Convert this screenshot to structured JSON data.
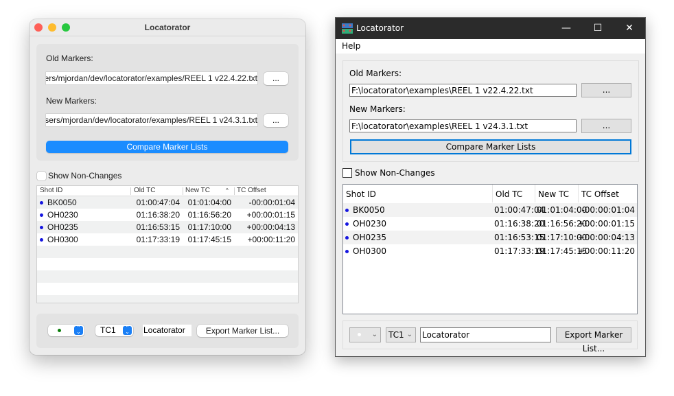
{
  "mac_window": {
    "title": "Locatorator",
    "traffic_lights": {
      "close": "#fe5f57",
      "minimize": "#febc2e",
      "zoom": "#28c840"
    },
    "old_markers_label": "Old Markers:",
    "old_markers_path": "ers/mjordan/dev/locatorator/examples/REEL 1 v22.4.22.txt",
    "browse_old_label": "...",
    "new_markers_label": "New Markers:",
    "new_markers_path": "sers/mjordan/dev/locatorator/examples/REEL 1 v24.3.1.txt",
    "browse_new_label": "...",
    "compare_label": "Compare Marker Lists",
    "show_non_changes_label": "Show Non-Changes",
    "show_non_changes_checked": false,
    "table": {
      "headers": [
        "Shot ID",
        "Old TC",
        "New TC",
        "TC Offset"
      ],
      "sort_indicator": "^",
      "rows": [
        {
          "id": "BK0050",
          "old": "01:00:47:04",
          "new": "01:01:04:00",
          "offset": "-00:00:01:04"
        },
        {
          "id": "OH0230",
          "old": "01:16:38:20",
          "new": "01:16:56:20",
          "offset": "+00:00:01:15"
        },
        {
          "id": "OH0235",
          "old": "01:16:53:15",
          "new": "01:17:10:00",
          "offset": "+00:00:04:13"
        },
        {
          "id": "OH0300",
          "old": "01:17:33:19",
          "new": "01:17:45:15",
          "offset": "+00:00:11:20"
        }
      ]
    },
    "marker_color_select": {
      "value": "green-dot",
      "color": "#0a7d0a"
    },
    "track_select": "TC1",
    "marker_name": "Locatorator",
    "export_label": "Export Marker List..."
  },
  "win_window": {
    "title": "Locatorator",
    "minimize_glyph": "—",
    "maximize_glyph": "☐",
    "close_glyph": "✕",
    "menu": [
      "Help"
    ],
    "old_markers_label": "Old Markers:",
    "old_markers_path": "F:\\locatorator\\examples\\REEL 1 v22.4.22.txt",
    "browse_old_label": "...",
    "new_markers_label": "New Markers:",
    "new_markers_path": "F:\\locatorator\\examples\\REEL 1 v24.3.1.txt",
    "browse_new_label": "...",
    "compare_label": "Compare Marker Lists",
    "show_non_changes_label": "Show Non-Changes",
    "show_non_changes_checked": false,
    "table": {
      "headers": [
        "Shot ID",
        "Old TC",
        "New TC",
        "TC Offset"
      ],
      "sort_indicator": "^",
      "rows": [
        {
          "id": "BK0050",
          "old": "01:00:47:04",
          "new": "01:01:04:00",
          "offset": "-00:00:01:04"
        },
        {
          "id": "OH0230",
          "old": "01:16:38:20",
          "new": "01:16:56:20",
          "offset": "+00:00:01:15"
        },
        {
          "id": "OH0235",
          "old": "01:16:53:15",
          "new": "01:17:10:00",
          "offset": "+00:00:04:13"
        },
        {
          "id": "OH0300",
          "old": "01:17:33:19",
          "new": "01:17:45:15",
          "offset": "+00:00:11:20"
        }
      ]
    },
    "marker_color_select": {
      "value": "white-dot",
      "color": "#ffffff"
    },
    "track_select": "TC1",
    "marker_name": "Locatorator",
    "export_label": "Export Marker List..."
  },
  "colors": {
    "marker_dot": "#1515e0",
    "mac_accent": "#1a8cff",
    "win_focus": "#0078d7"
  }
}
